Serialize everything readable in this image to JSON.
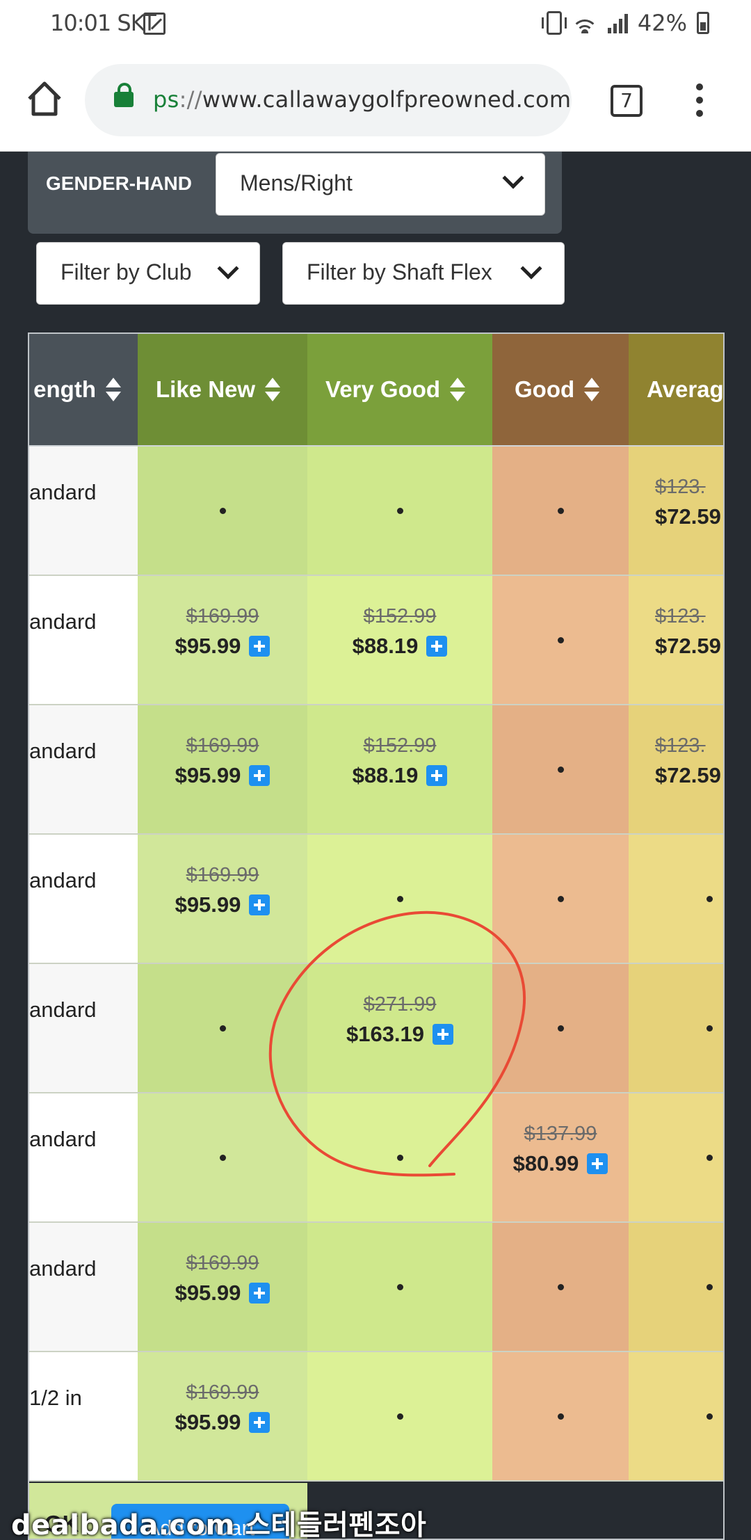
{
  "status_bar": {
    "time": "10:01",
    "carrier": "SKT",
    "battery": "42%"
  },
  "browser": {
    "url_scheme": "ps",
    "url_sep": "://",
    "url_host": "www.callawaygolfpreowned.com",
    "tab_count": "7"
  },
  "filters": {
    "gender_label": "GENDER-HAND",
    "gender_value": "Mens/Right",
    "club_label": "Filter by Club",
    "shaft_label": "Filter by Shaft Flex"
  },
  "table": {
    "columns": [
      "ength",
      "Like New",
      "Very Good",
      "Good",
      "Averag"
    ],
    "rows": [
      {
        "length": "andard",
        "like_new_old": "",
        "like_new": "",
        "very_good_old": "",
        "very_good": "",
        "good_old": "",
        "good": "",
        "avg_old": "$123.",
        "avg": "$72.59"
      },
      {
        "length": "andard",
        "like_new_old": "$169.99",
        "like_new": "$95.99",
        "very_good_old": "$152.99",
        "very_good": "$88.19",
        "good_old": "",
        "good": "",
        "avg_old": "$123.",
        "avg": "$72.59"
      },
      {
        "length": "andard",
        "like_new_old": "$169.99",
        "like_new": "$95.99",
        "very_good_old": "$152.99",
        "very_good": "$88.19",
        "good_old": "",
        "good": "",
        "avg_old": "$123.",
        "avg": "$72.59"
      },
      {
        "length": "andard",
        "like_new_old": "$169.99",
        "like_new": "$95.99",
        "very_good_old": "",
        "very_good": "",
        "good_old": "",
        "good": "",
        "avg_old": "",
        "avg": ""
      },
      {
        "length": "andard",
        "like_new_old": "",
        "like_new": "",
        "very_good_old": "$271.99",
        "very_good": "$163.19",
        "good_old": "",
        "good": "",
        "avg_old": "",
        "avg": ""
      },
      {
        "length": "andard",
        "like_new_old": "",
        "like_new": "",
        "very_good_old": "",
        "very_good": "",
        "good_old": "$137.99",
        "good": "$80.99",
        "avg_old": "",
        "avg": ""
      },
      {
        "length": "andard",
        "like_new_old": "$169.99",
        "like_new": "$95.99",
        "very_good_old": "",
        "very_good": "",
        "good_old": "",
        "good": "",
        "avg_old": "",
        "avg": ""
      },
      {
        "length": "1/2 in",
        "like_new_old": "$169.99",
        "like_new": "$95.99",
        "very_good_old": "",
        "very_good": "",
        "good_old": "",
        "good": "",
        "avg_old": "",
        "avg": ""
      }
    ],
    "bottom_ok": "OK",
    "bottom_add": "Add to Cart"
  },
  "colors": {
    "header_length": "#4a5259",
    "header_like_new": "#6e8e35",
    "header_very_good": "#7ba03b",
    "header_good": "#8f653b",
    "header_average": "#908330",
    "col_like_new_a": "#c5df8a",
    "col_like_new_b": "#d1e79a",
    "col_very_good_a": "#cfe88c",
    "col_very_good_b": "#dcf196",
    "col_good_a": "#e4b086",
    "col_good_b": "#ecbb90",
    "col_avg_a": "#e6d27a",
    "col_avg_b": "#ecdb86",
    "plus_icon": "#1e90f0",
    "annotation": "#e94a35"
  },
  "watermark": "dealbada.com  스테들러펜조아"
}
